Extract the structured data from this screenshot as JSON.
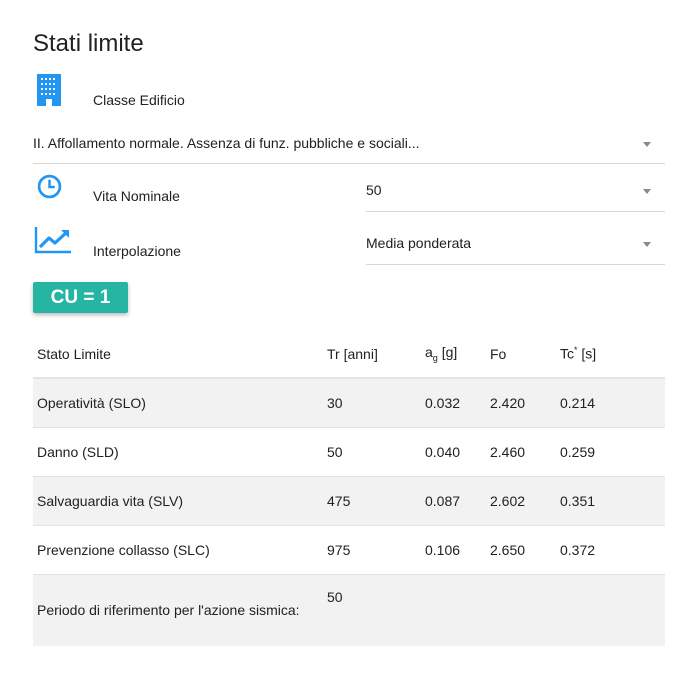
{
  "title": "Stati limite",
  "classe_edificio": {
    "label": "Classe Edificio",
    "value": "II. Affollamento normale. Assenza di funz. pubbliche e sociali..."
  },
  "vita_nominale": {
    "label": "Vita Nominale",
    "value": "50"
  },
  "interpolazione": {
    "label": "Interpolazione",
    "value": "Media ponderata"
  },
  "cu_badge": "CU = 1",
  "table": {
    "headers": {
      "stato": "Stato Limite",
      "tr": "Tr [anni]",
      "ag_main": "a",
      "ag_sub": "g",
      "ag_unit": " [g]",
      "fo": "Fo",
      "tc_main": "Tc",
      "tc_sup": "*",
      "tc_unit": " [s]"
    },
    "rows": [
      {
        "stato": "Operatività (SLO)",
        "tr": "30",
        "ag": "0.032",
        "fo": "2.420",
        "tc": "0.214"
      },
      {
        "stato": "Danno (SLD)",
        "tr": "50",
        "ag": "0.040",
        "fo": "2.460",
        "tc": "0.259"
      },
      {
        "stato": "Salvaguardia vita (SLV)",
        "tr": "475",
        "ag": "0.087",
        "fo": "2.602",
        "tc": "0.351"
      },
      {
        "stato": "Prevenzione collasso (SLC)",
        "tr": "975",
        "ag": "0.106",
        "fo": "2.650",
        "tc": "0.372"
      }
    ],
    "footer": {
      "label": "Periodo di riferimento per l'azione sismica:",
      "value": "50"
    }
  },
  "colors": {
    "accent": "#2196f3",
    "badge": "#26b5a3"
  },
  "icons": {
    "classe_edificio": "building-icon",
    "vita_nominale": "clock-icon",
    "interpolazione": "trending-up-icon",
    "dropdown": "caret-down-icon"
  }
}
